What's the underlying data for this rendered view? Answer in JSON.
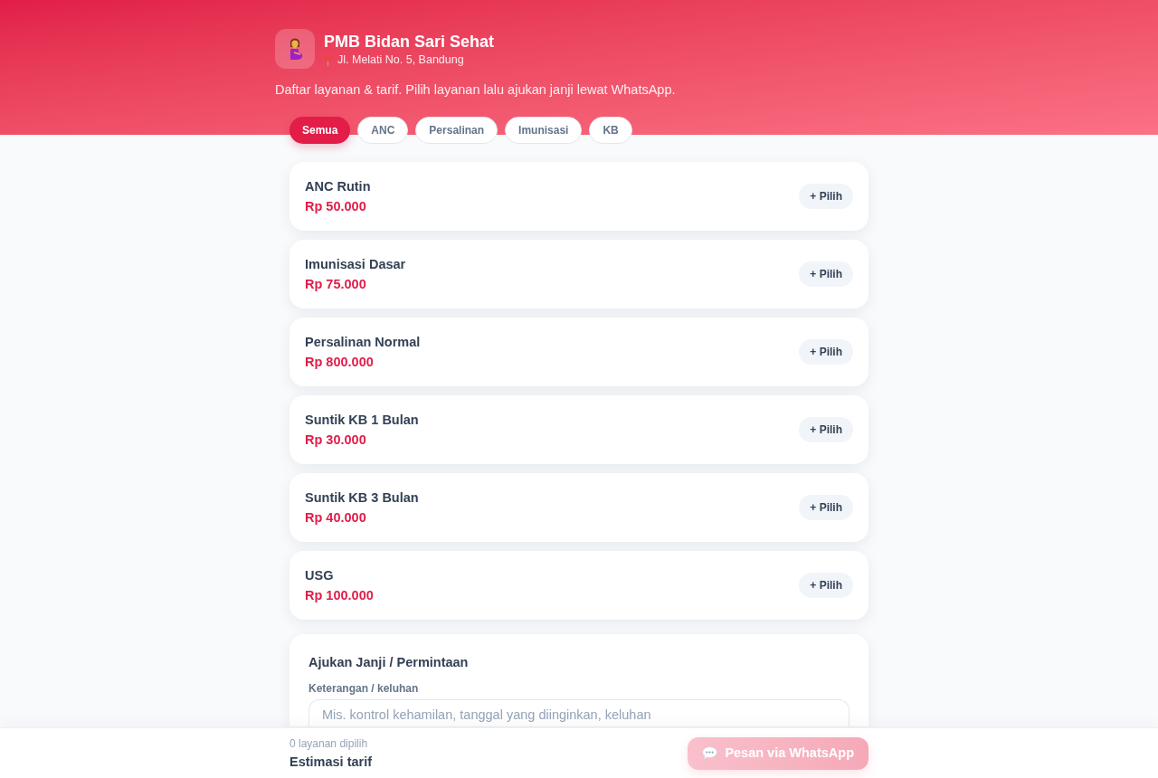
{
  "header": {
    "title": "PMB Bidan Sari Sehat",
    "address": "Jl. Melati No. 5, Bandung",
    "description": "Daftar layanan & tarif. Pilih layanan lalu ajukan janji lewat WhatsApp."
  },
  "filters": [
    {
      "label": "Semua",
      "selected": true
    },
    {
      "label": "ANC",
      "selected": false
    },
    {
      "label": "Persalinan",
      "selected": false
    },
    {
      "label": "Imunisasi",
      "selected": false
    },
    {
      "label": "KB",
      "selected": false
    }
  ],
  "services": [
    {
      "name": "ANC Rutin",
      "price": "Rp 50.000",
      "button": "+ Pilih"
    },
    {
      "name": "Imunisasi Dasar",
      "price": "Rp 75.000",
      "button": "+ Pilih"
    },
    {
      "name": "Persalinan Normal",
      "price": "Rp 800.000",
      "button": "+ Pilih"
    },
    {
      "name": "Suntik KB 1 Bulan",
      "price": "Rp 30.000",
      "button": "+ Pilih"
    },
    {
      "name": "Suntik KB 3 Bulan",
      "price": "Rp 40.000",
      "button": "+ Pilih"
    },
    {
      "name": "USG",
      "price": "Rp 100.000",
      "button": "+ Pilih"
    }
  ],
  "request_form": {
    "title": "Ajukan Janji / Permintaan",
    "field_label": "Keterangan / keluhan",
    "placeholder": "Mis. kontrol kehamilan, tanggal yang diinginkan, keluhan"
  },
  "footer": {
    "selected_count": "0 layanan dipilih",
    "estimate_label": "Estimasi tarif",
    "button": {
      "label": "Pesan via WhatsApp",
      "disabled": true
    }
  }
}
